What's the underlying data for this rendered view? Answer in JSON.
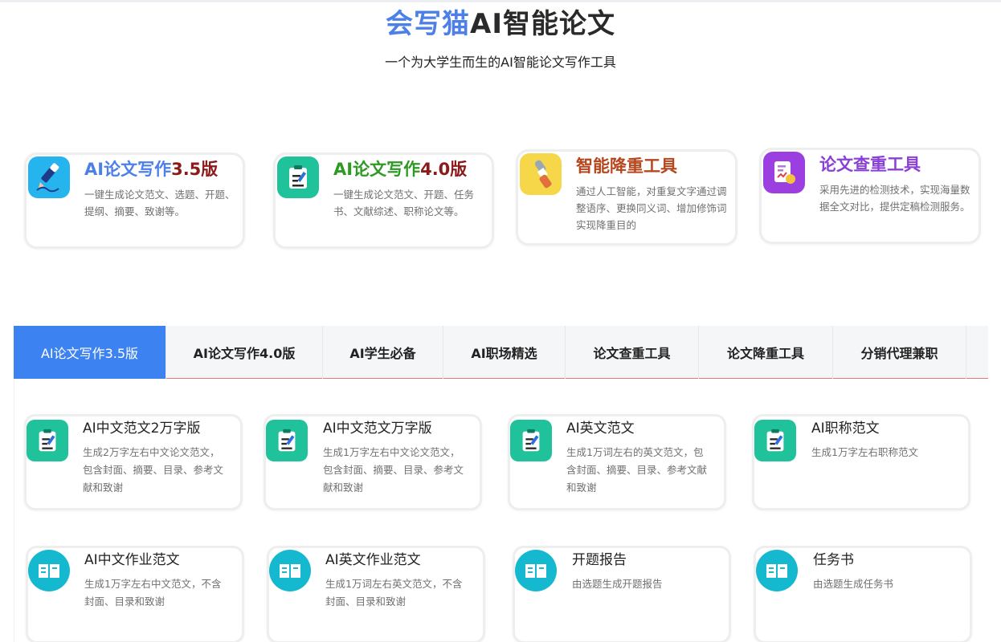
{
  "hero": {
    "brand": "会写猫",
    "title_rest": "AI智能论文",
    "subtitle": "一个为大学生而生的AI智能论文写作工具"
  },
  "features": [
    {
      "title_main": "AI论文写作",
      "title_version": "3.5版",
      "desc": "一键生成论文范文、选题、开题、提纲、摘要、致谢等。",
      "icon": "pen-writing-icon"
    },
    {
      "title_main": "AI论文写作",
      "title_version": "4.0版",
      "desc": "一键生成论文范文、开题、任务书、文献综述、职称论文等。",
      "icon": "clipboard-edit-icon"
    },
    {
      "title": "智能降重工具",
      "desc": "通过人工智能，对重复文字通过调整语序、更换同义词、增加修饰词实现降重目的",
      "icon": "brush-icon"
    },
    {
      "title": "论文查重工具",
      "desc": "采用先进的检测技术，实现海量数据全文对比，提供定稿检测服务。",
      "icon": "report-check-icon"
    }
  ],
  "colors": {
    "brand_blue": "#4d7fe9",
    "version_red": "#8b1a1a",
    "green_title": "#2e9a24",
    "orange_title": "#b5461d",
    "purple_title": "#8a3fd6",
    "tab_active": "#3c83f1"
  },
  "tabs": [
    "AI论文写作3.5版",
    "AI论文写作4.0版",
    "AI学生必备",
    "AI职场精选",
    "论文查重工具",
    "论文降重工具",
    "分销代理兼职"
  ],
  "active_tab": "AI论文写作3.5版",
  "products": [
    {
      "title": "AI中文范文2万字版",
      "desc": "生成2万字左右中文论文范文，包含封面、摘要、目录、参考文献和致谢",
      "icon": "clipboard-edit-icon"
    },
    {
      "title": "AI中文范文万字版",
      "desc": "生成1万字左右中文论文范文，包含封面、摘要、目录、参考文献和致谢",
      "icon": "clipboard-edit-icon"
    },
    {
      "title": "AI英文范文",
      "desc": "生成1万词左右的英文范文，包含封面、摘要、目录、参考文献和致谢",
      "icon": "clipboard-edit-icon"
    },
    {
      "title": "AI职称范文",
      "desc": "生成1万字左右职称范文",
      "icon": "clipboard-edit-icon"
    },
    {
      "title": "AI中文作业范文",
      "desc": "生成1万字左右中文范文，不含封面、目录和致谢",
      "icon": "open-book-icon"
    },
    {
      "title": "AI英文作业范文",
      "desc": "生成1万词左右英文范文，不含封面、目录和致谢",
      "icon": "open-book-icon"
    },
    {
      "title": "开题报告",
      "desc": "由选题生成开题报告",
      "icon": "open-book-icon"
    },
    {
      "title": "任务书",
      "desc": "由选题生成任务书",
      "icon": "open-book-icon"
    }
  ]
}
